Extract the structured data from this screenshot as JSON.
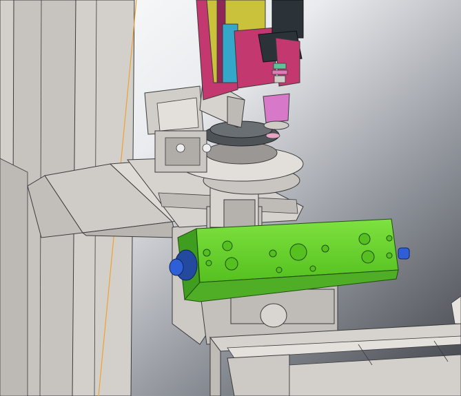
{
  "viewport": {
    "background_gradient": [
      "#ffffff",
      "#e9ebee",
      "#8a8e95",
      "#3e4247"
    ]
  },
  "colors": {
    "frame_gray": "#cfccc8",
    "frame_dark": "#a9a6a2",
    "edge": "#3a3a3a",
    "magenta": "#c2386f",
    "yellow": "#c9c23a",
    "cyan": "#35a8c9",
    "motor_dark": "#2b3238",
    "pink_collet": "#d878c8",
    "green_block": "#66d62f",
    "green_shadow": "#3f9e1f",
    "blue_fitting": "#2f5fd6",
    "orange_line": "#f0a030"
  },
  "parts": [
    "frame-post",
    "hopper-tray",
    "spindle-motor",
    "rotary-table",
    "pneumatic-cylinder",
    "manifold-block",
    "bottom-frame"
  ]
}
